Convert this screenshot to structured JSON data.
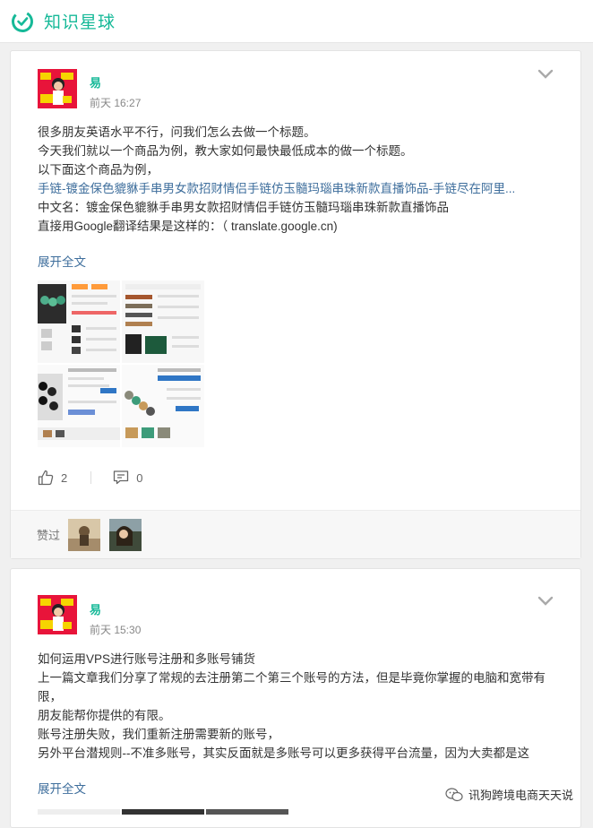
{
  "app": {
    "title": "知识星球",
    "brand_color": "#16b998",
    "link_color": "#3e6e9c"
  },
  "posts": [
    {
      "author": "易",
      "time": "前天 16:27",
      "lines": [
        "很多朋友英语水平不行，问我们怎么去做一个标题。",
        "今天我们就以一个商品为例，教大家如何最快最低成本的做一个标题。",
        "以下面这个商品为例，",
        "手链-镀金保色貔貅手串男女款招财情侣手链仿玉髓玛瑙串珠新款直播饰品-手链尽在阿里...",
        "中文名：镀金保色貔貅手串男女款招财情侣手链仿玉髓玛瑙串珠新款直播饰品",
        "直接用Google翻译结果是这样的：（ translate.google.cn)"
      ],
      "expand": "展开全文",
      "like_count": "2",
      "comment_count": "0",
      "likes_label": "赞过"
    },
    {
      "author": "易",
      "time": "前天 15:30",
      "lines": [
        "如何运用VPS进行账号注册和多账号铺货",
        "上一篇文章我们分享了常规的去注册第二个第三个账号的方法，但是毕竟你掌握的电脑和宽带有限，",
        "朋友能帮你提供的有限。",
        "账号注册失败，我们重新注册需要新的账号，",
        "另外平台潜规则--不准多账号，其实反面就是多账号可以更多获得平台流量，因为大卖都是这"
      ],
      "expand": "展开全文"
    }
  ],
  "watermark": "讯狗跨境电商天天说"
}
